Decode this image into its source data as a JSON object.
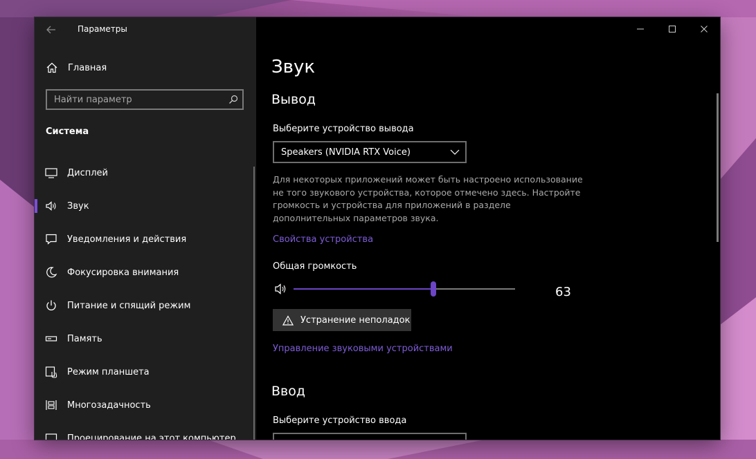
{
  "window": {
    "title": "Параметры"
  },
  "sidebar": {
    "home_label": "Главная",
    "search_placeholder": "Найти параметр",
    "section_title": "Система",
    "items": [
      {
        "label": "Дисплей",
        "icon": "display-icon",
        "active": false
      },
      {
        "label": "Звук",
        "icon": "speaker-icon",
        "active": true
      },
      {
        "label": "Уведомления и действия",
        "icon": "notification-icon",
        "active": false
      },
      {
        "label": "Фокусировка внимания",
        "icon": "moon-icon",
        "active": false
      },
      {
        "label": "Питание и спящий режим",
        "icon": "power-icon",
        "active": false
      },
      {
        "label": "Память",
        "icon": "storage-icon",
        "active": false
      },
      {
        "label": "Режим планшета",
        "icon": "tablet-icon",
        "active": false
      },
      {
        "label": "Многозадачность",
        "icon": "multitasking-icon",
        "active": false
      },
      {
        "label": "Проецирование на этот компьютер",
        "icon": "projecting-icon",
        "active": false
      }
    ]
  },
  "main": {
    "page_title": "Звук",
    "output": {
      "heading": "Вывод",
      "device_label": "Выберите устройство вывода",
      "device_value": "Speakers (NVIDIA RTX Voice)",
      "description": "Для некоторых приложений может быть настроено использование не того звукового устройства, которое отмечено здесь. Настройте громкость и устройства для приложений в разделе дополнительных параметров звука.",
      "device_properties_link": "Свойства устройства",
      "volume_label": "Общая громкость",
      "volume_value": "63",
      "volume_fraction": 0.63,
      "troubleshoot_label": "Устранение неполадок",
      "manage_devices_link": "Управление звуковыми устройствами"
    },
    "input": {
      "heading": "Ввод",
      "device_label": "Выберите устройство ввода"
    }
  },
  "colors": {
    "accent": "#6b45c6",
    "link": "#7d5cd6",
    "sidebar_bg": "#1f1f1f",
    "content_bg": "#000000"
  }
}
